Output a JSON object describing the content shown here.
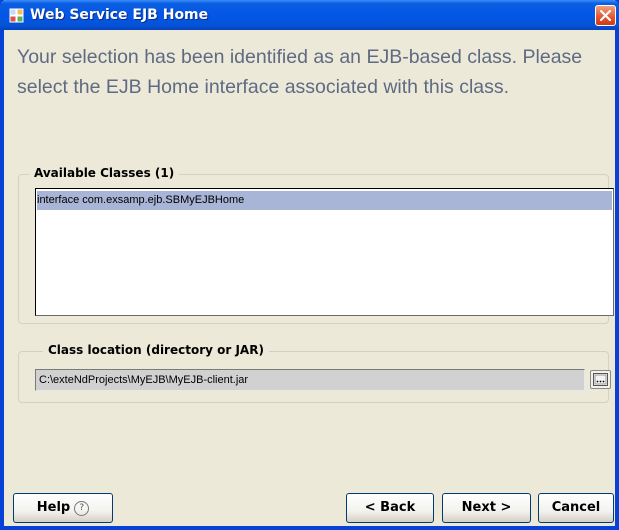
{
  "window": {
    "title": "Web Service EJB Home"
  },
  "headline": "Your selection has been identified as an EJB-based class. Please select the EJB Home interface associated with this class.",
  "available_classes": {
    "legend": "Available Classes (1)",
    "items": [
      "interface com.exsamp.ejb.SBMyEJBHome"
    ],
    "selected_index": 0
  },
  "class_location": {
    "legend": "Class location (directory or JAR)",
    "value": "C:\\exteNdProjects\\MyEJB\\MyEJB-client.jar"
  },
  "buttons": {
    "help": "Help",
    "help_icon_glyph": "?",
    "back": "< Back",
    "next": "Next >",
    "cancel": "Cancel"
  },
  "colors": {
    "titlebar": "#0456e6",
    "selection": "#a9b5d6",
    "dialog_bg": "#ece9d8",
    "headline_text": "#5f6a83"
  },
  "icons": {
    "app": "ejb-app-icon",
    "close": "close-icon",
    "browse": "browse-ellipsis-icon",
    "help": "help-circle-icon"
  }
}
